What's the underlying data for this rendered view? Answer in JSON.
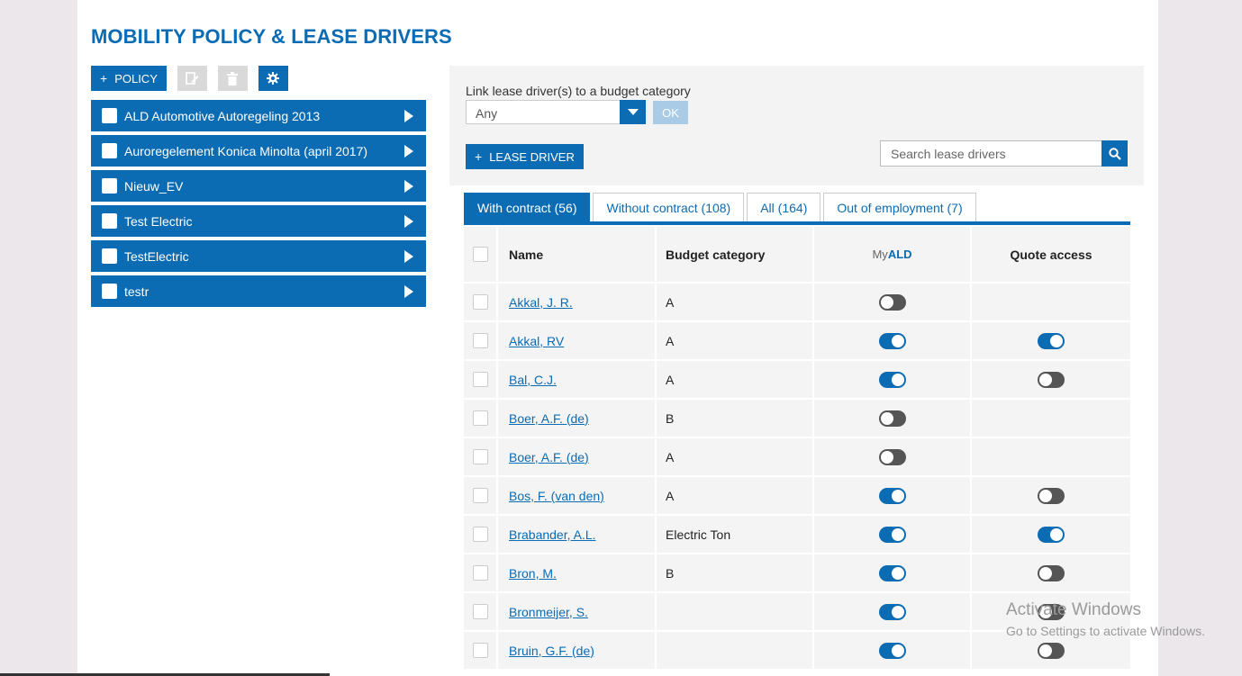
{
  "page": {
    "title": "MOBILITY POLICY & LEASE DRIVERS"
  },
  "toolbar": {
    "add_policy_label": "POLICY",
    "plus": "+"
  },
  "policies": [
    "ALD Automotive Autoregeling 2013",
    "Auroregelement Konica Minolta (april 2017)",
    "Nieuw_EV",
    "Test Electric",
    "TestElectric",
    "testr"
  ],
  "filter": {
    "label": "Link lease driver(s) to a budget category",
    "selected": "Any",
    "ok_label": "OK",
    "add_driver_label": "LEASE DRIVER",
    "search_placeholder": "Search lease drivers"
  },
  "tabs": [
    {
      "label": "With contract (56)",
      "active": true
    },
    {
      "label": "Without contract (108)",
      "active": false
    },
    {
      "label": "All (164)",
      "active": false
    },
    {
      "label": "Out of employment (7)",
      "active": false
    }
  ],
  "table": {
    "headers": {
      "name": "Name",
      "budget": "Budget category",
      "myald_my": "My",
      "myald_ald": "ALD",
      "quote": "Quote access"
    },
    "rows": [
      {
        "name": "Akkal, J. R.",
        "budget": "A",
        "myald": false,
        "quote": null
      },
      {
        "name": "Akkal, RV",
        "budget": "A",
        "myald": true,
        "quote": true
      },
      {
        "name": "Bal, C.J.",
        "budget": "A",
        "myald": true,
        "quote": false
      },
      {
        "name": "Boer, A.F. (de)",
        "budget": "B",
        "myald": false,
        "quote": null
      },
      {
        "name": "Boer, A.F. (de)",
        "budget": "A",
        "myald": false,
        "quote": null
      },
      {
        "name": "Bos, F. (van den)",
        "budget": "A",
        "myald": true,
        "quote": false
      },
      {
        "name": "Brabander, A.L.",
        "budget": "Electric Ton",
        "myald": true,
        "quote": true
      },
      {
        "name": "Bron, M.",
        "budget": "B",
        "myald": true,
        "quote": false
      },
      {
        "name": "Bronmeijer, S.",
        "budget": "",
        "myald": true,
        "quote": false
      },
      {
        "name": "Bruin, G.F. (de)",
        "budget": "",
        "myald": true,
        "quote": false
      }
    ]
  },
  "watermark": {
    "line1": "Activate Windows",
    "line2": "Go to Settings to activate Windows."
  },
  "colors": {
    "brand": "#0b6bb3",
    "toggle_off": "#555555"
  },
  "icons": {
    "edit": "edit-icon",
    "delete": "trash-icon",
    "settings": "gear-icon",
    "search": "search-icon"
  }
}
